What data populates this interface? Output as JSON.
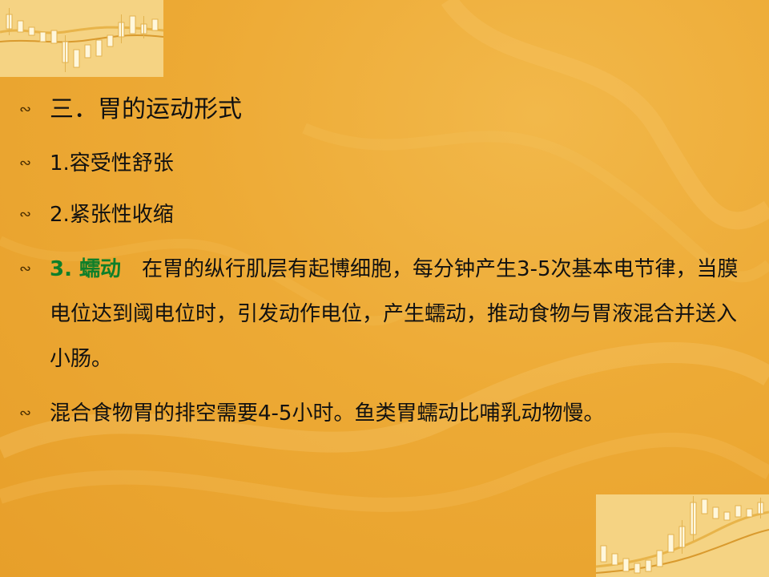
{
  "slide": {
    "title": "三．胃的运动形式",
    "items": [
      {
        "text": "1.容受性舒张"
      },
      {
        "text": "2.紧张性收缩"
      }
    ],
    "peristalsis": {
      "label": "3. 蠕动",
      "text": "在胃的纵行肌层有起博细胞，每分钟产生3-5次基本电节律，当膜电位达到阈电位时，引发动作电位，产生蠕动，推动食物与胃液混合并送入小肠。"
    },
    "note": "混合食物胃的排空需要4-5小时。鱼类胃蠕动比哺乳动物慢。",
    "bullet_icon": "wave-bullet-icon"
  },
  "colors": {
    "background": "#edaa35",
    "text": "#111111",
    "highlight": "#0e7f2a"
  }
}
